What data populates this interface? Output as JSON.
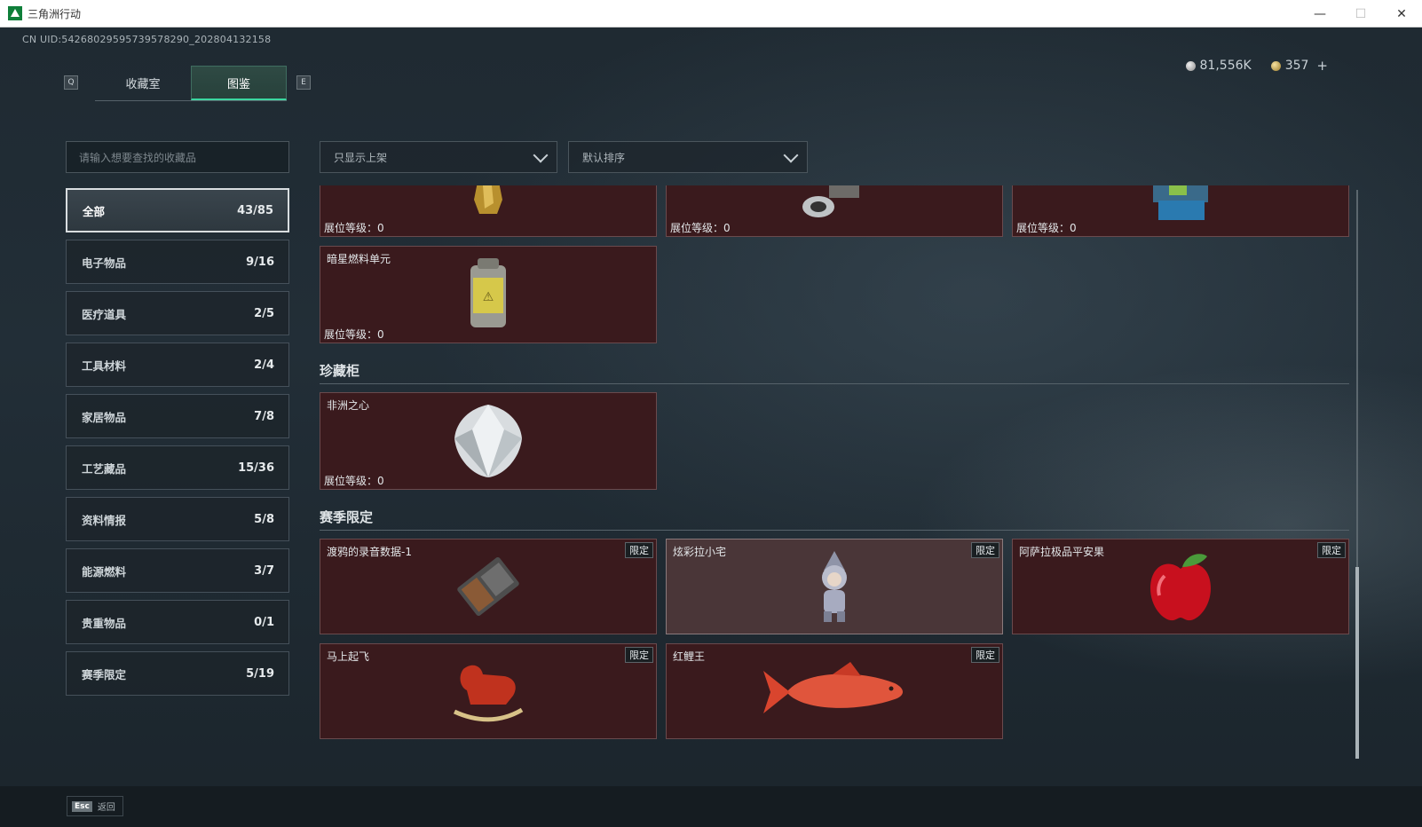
{
  "window": {
    "title": "三角洲行动",
    "controls": {
      "minimize": "—",
      "maximize": "☐",
      "close": "✕"
    }
  },
  "uid": "CN UID:54268029595739578290_202804132158",
  "keys": {
    "left": "Q",
    "right": "E",
    "back_key": "Esc"
  },
  "tabs": [
    {
      "label": "收藏室",
      "active": false
    },
    {
      "label": "图鉴",
      "active": true
    }
  ],
  "currency": {
    "silver": "81,556K",
    "gold": "357",
    "plus": "+"
  },
  "search": {
    "placeholder": "请输入想要查找的收藏品"
  },
  "filters": {
    "show": "只显示上架",
    "sort": "默认排序"
  },
  "categories": [
    {
      "label": "全部",
      "count": "43/85",
      "active": true
    },
    {
      "label": "电子物品",
      "count": "9/16"
    },
    {
      "label": "医疗道具",
      "count": "2/5"
    },
    {
      "label": "工具材料",
      "count": "2/4"
    },
    {
      "label": "家居物品",
      "count": "7/8"
    },
    {
      "label": "工艺藏品",
      "count": "15/36"
    },
    {
      "label": "资料情报",
      "count": "5/8"
    },
    {
      "label": "能源燃料",
      "count": "3/7"
    },
    {
      "label": "贵重物品",
      "count": "0/1"
    },
    {
      "label": "赛季限定",
      "count": "5/19"
    }
  ],
  "cards_top": [
    {
      "level": "展位等级：0",
      "icon": "gold-statue-icon"
    },
    {
      "level": "展位等级：0",
      "icon": "metal-part-icon"
    },
    {
      "level": "展位等级：0",
      "icon": "circuit-device-icon"
    }
  ],
  "fuel_card": {
    "name": "暗星燃料单元",
    "level": "展位等级：0",
    "icon": "fuel-canister-icon"
  },
  "sections": {
    "cabinet": {
      "title": "珍藏柜",
      "items": [
        {
          "name": "非洲之心",
          "level": "展位等级：0",
          "icon": "diamond-icon"
        }
      ]
    },
    "season": {
      "title": "赛季限定",
      "badge": "限定",
      "items": [
        {
          "name": "渡鸦的录音数据-1",
          "icon": "tape-cassette-icon"
        },
        {
          "name": "炫彩拉小宅",
          "icon": "doll-figure-icon"
        },
        {
          "name": "阿萨拉极品平安果",
          "icon": "red-apple-icon"
        },
        {
          "name": "马上起飞",
          "icon": "rocking-horse-icon"
        },
        {
          "name": "红鲤王",
          "icon": "red-carp-icon"
        }
      ]
    }
  },
  "back": {
    "label": "返回"
  },
  "colors": {
    "accent": "#3bd6a0",
    "card_bg": "#3a1a1d",
    "card_hl": "#4a3638"
  }
}
